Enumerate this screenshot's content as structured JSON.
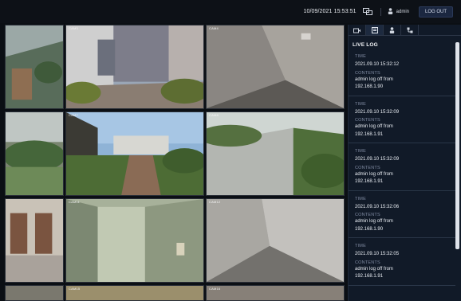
{
  "topbar": {
    "datetime": "10/09/2021 15:53:51",
    "screen_icon": "display-icon",
    "user_icon": "user-icon",
    "username": "admin",
    "logout_label": "LOG OUT"
  },
  "cameras": [
    {
      "label": ""
    },
    {
      "label": "CAM3"
    },
    {
      "label": "CAM4"
    },
    {
      "label": ""
    },
    {
      "label": "CAM7"
    },
    {
      "label": "CAM8"
    },
    {
      "label": ""
    },
    {
      "label": "CAM11"
    },
    {
      "label": "CAM12"
    },
    {
      "label": ""
    },
    {
      "label": "CAM15"
    },
    {
      "label": "CAM16"
    }
  ],
  "panel": {
    "tabs": [
      "camera-icon",
      "log-icon",
      "user-icon",
      "network-icon"
    ],
    "title": "LIVE LOG",
    "entries": [
      {
        "time_label": "TIME",
        "time": "2021.09.10 15:32:12",
        "contents_label": "CONTENTS",
        "line1": "admin log off from",
        "line2": "192.168.1.90"
      },
      {
        "time_label": "TIME",
        "time": "2021.09.10 15:32:09",
        "contents_label": "CONTENTS",
        "line1": "admin log off from",
        "line2": "192.168.1.91"
      },
      {
        "time_label": "TIME",
        "time": "2021.09.10 15:32:09",
        "contents_label": "CONTENTS",
        "line1": "admin log off from",
        "line2": "192.168.1.91"
      },
      {
        "time_label": "TIME",
        "time": "2021.09.10 15:32:06",
        "contents_label": "CONTENTS",
        "line1": "admin log off from",
        "line2": "192.168.1.90"
      },
      {
        "time_label": "TIME",
        "time": "2021.09.10 15:32:05",
        "contents_label": "CONTENTS",
        "line1": "admin log off from",
        "line2": "192.168.1.91"
      }
    ]
  },
  "colors": {
    "background": "#0b0f14",
    "panel": "#111a28",
    "accent": "#1b2740"
  }
}
